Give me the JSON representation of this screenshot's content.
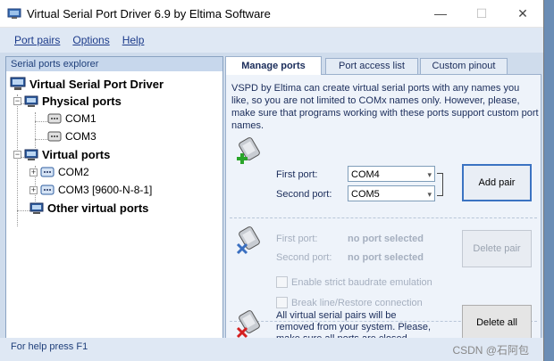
{
  "window": {
    "title": "Virtual Serial Port Driver 6.9 by Eltima Software",
    "controls": {
      "minimize": "—",
      "maximize": "☐",
      "close": "✕"
    }
  },
  "menu": {
    "items": [
      {
        "label": "Port pairs"
      },
      {
        "label": "Options"
      },
      {
        "label": "Help"
      }
    ]
  },
  "explorer": {
    "header": "Serial ports explorer",
    "root": "Virtual Serial Port Driver",
    "physical": {
      "label": "Physical ports",
      "items": [
        "COM1",
        "COM3"
      ]
    },
    "virtual": {
      "label": "Virtual ports",
      "items": [
        "COM2",
        "COM3 [9600-N-8-1]"
      ]
    },
    "other": {
      "label": "Other virtual ports"
    }
  },
  "tabs": [
    {
      "label": "Manage ports",
      "active": true
    },
    {
      "label": "Port access list",
      "active": false
    },
    {
      "label": "Custom pinout",
      "active": false
    }
  ],
  "manage": {
    "description": "VSPD by Eltima can create virtual serial ports with any names you like, so you are not limited to COMx names only. However, please, make sure that programs working with these ports support custom port names.",
    "add": {
      "first_label": "First port:",
      "first_value": "COM4",
      "second_label": "Second port:",
      "second_value": "COM5",
      "button": "Add pair"
    },
    "delete": {
      "first_label": "First port:",
      "first_value": "no port selected",
      "second_label": "Second port:",
      "second_value": "no port selected",
      "button": "Delete pair",
      "option1": "Enable strict baudrate emulation",
      "option2": "Break line/Restore connection"
    },
    "delete_all": {
      "text": "All virtual serial pairs will be removed from your system. Please, make sure all ports are closed.",
      "button": "Delete all"
    }
  },
  "status": {
    "text": "For help press F1",
    "watermark": "CSDN @石阿包"
  },
  "colors": {
    "accent": "#1b3a8a",
    "panel_bg": "#eef3fa",
    "content_bg": "#cfdcec"
  }
}
